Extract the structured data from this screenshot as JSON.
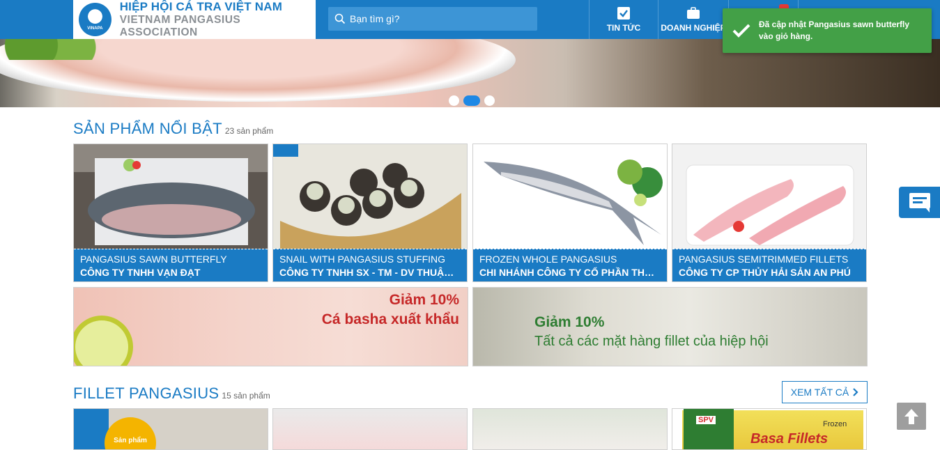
{
  "header": {
    "logo_vn": "HIỆP HỘI CÁ TRA VIỆT NAM",
    "logo_en": "VIETNAM PANGASIUS ASSOCIATION",
    "logo_mark": "VINAPA",
    "search_placeholder": "Bạn tìm gì?",
    "nav": [
      {
        "label": "TIN TỨC",
        "icon": "check-square-icon"
      },
      {
        "label": "DOANH NGHIỆP",
        "icon": "briefcase-icon"
      },
      {
        "label": "",
        "icon": "cart-icon"
      }
    ]
  },
  "toast": {
    "message": "Đã cập nhật Pangasius sawn butterfly vào giỏ hàng.",
    "color": "#43a047"
  },
  "banner": {
    "slides": 3,
    "active_slide": 2
  },
  "featured": {
    "title": "SẢN PHẨM NỔI BẬT",
    "count": "23 sản phẩm",
    "products": [
      {
        "name": "PANGASIUS SAWN BUTTERFLY",
        "company": "CÔNG TY TNHH VẠN ĐẠT"
      },
      {
        "name": "SNAIL WITH PANGASIUS STUFFING",
        "company": "CÔNG TY TNHH SX - TM - DV THUẬN HƯNG"
      },
      {
        "name": "FROZEN WHOLE PANGASIUS",
        "company": "CHI NHÁNH CÔNG TY CỔ PHẦN THỦY SẢN"
      },
      {
        "name": "PANGASIUS SEMITRIMMED FILLETS",
        "company": "CÔNG TY CP THỦY HẢI SẢN AN PHÚ"
      }
    ]
  },
  "promos": [
    {
      "line1": "Giảm 10%",
      "line2": "Cá basha xuất khẩu"
    },
    {
      "line1": "Giảm 10%",
      "line2": "Tất cả các mặt hàng fillet của hiệp hội"
    }
  ],
  "fillet": {
    "title": "FILLET PANGASIUS",
    "count": "15 sản phẩm",
    "view_all": "XEM TẤT CẢ",
    "card1_badge": "Sản phẩm",
    "card4_brand": "SPV",
    "card4_frozen": "Frozen",
    "card4_label": "Basa Fillets"
  },
  "colors": {
    "primary": "#1a7bc4",
    "toast": "#43a047",
    "promo_text": "#c62828",
    "promo_text_green": "#2e7d32"
  }
}
